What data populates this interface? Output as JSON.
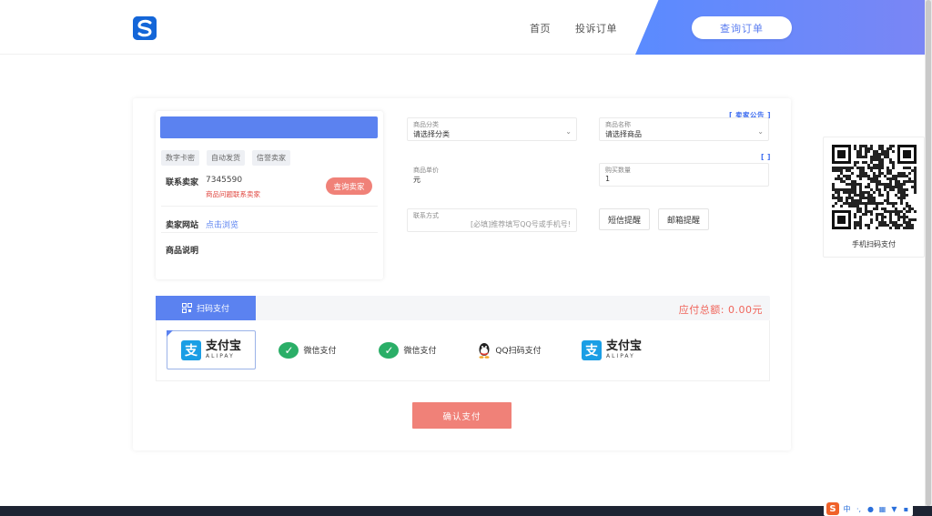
{
  "header": {
    "nav_home": "首页",
    "nav_complaint": "投诉订单",
    "query_order_label": "查询订单",
    "accent_color": "#5a8bff"
  },
  "seller": {
    "tags": [
      "数字卡密",
      "自动发货",
      "信誉卖家"
    ],
    "contact_label": "联系卖家",
    "contact_value": "7345590",
    "contact_note": "商品问题联系卖家",
    "query_seller_label": "查询卖家",
    "site_label": "卖家网站",
    "site_link": "点击浏览",
    "desc_label": "商品说明"
  },
  "form": {
    "notice": "[ 卖家公告 ]",
    "notice2": "[ ]",
    "category": {
      "label": "商品分类",
      "value": "请选择分类"
    },
    "product": {
      "label": "商品名称",
      "value": "请选择商品"
    },
    "price": {
      "label": "商品单价",
      "value": "元"
    },
    "quantity": {
      "label": "购买数量",
      "value": "1"
    },
    "contact": {
      "label": "联系方式",
      "placeholder": "[必填]推荐填写QQ号或手机号!"
    },
    "sms_remind": "短信提醒",
    "email_remind": "邮箱提醒"
  },
  "payment": {
    "scan_tab": "扫码支付",
    "total_label": "应付总额:",
    "total_value": "0.00元",
    "methods": [
      {
        "name": "支付宝",
        "sub": "ALIPAY",
        "icon": "alipay-icon"
      },
      {
        "name": "微信支付",
        "icon": "wechat-icon"
      },
      {
        "name": "微信支付",
        "icon": "wechat-icon"
      },
      {
        "name": "QQ扫码支付",
        "icon": "qq-icon"
      },
      {
        "name": "支付宝",
        "sub": "ALIPAY",
        "icon": "alipay-icon"
      }
    ],
    "selected_index": 0,
    "confirm_label": "确认支付"
  },
  "qr": {
    "caption": "手机扫码支付"
  }
}
